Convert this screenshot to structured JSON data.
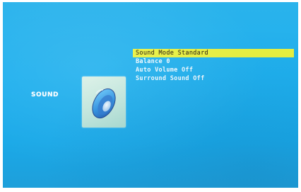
{
  "menu": {
    "category": "SOUND",
    "items": [
      {
        "label": "Sound Mode Standard",
        "selected": true
      },
      {
        "label": "Balance 0",
        "selected": false
      },
      {
        "label": "Auto Volume Off",
        "selected": false
      },
      {
        "label": "Surround Sound Off",
        "selected": false
      }
    ]
  },
  "icons": {
    "category_icon": "speaker-icon"
  },
  "colors": {
    "background": "#1fb0ee",
    "highlight": "#e9f13f",
    "text": "#ffffff",
    "tile": "#bfe6dc"
  }
}
